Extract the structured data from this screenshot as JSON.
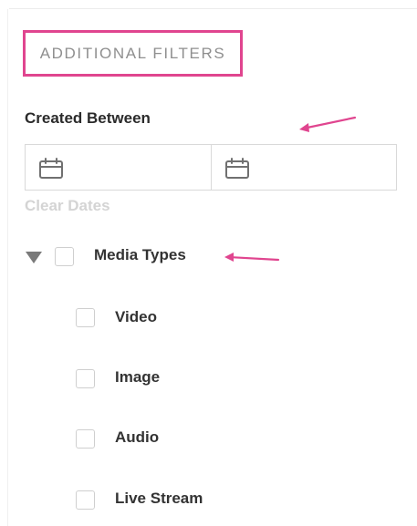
{
  "panel": {
    "header": "ADDITIONAL FILTERS",
    "created_between_label": "Created Between",
    "start_date": {
      "value": "",
      "icon": "calendar-icon"
    },
    "end_date": {
      "value": "",
      "icon": "calendar-icon"
    },
    "clear_dates_label": "Clear Dates"
  },
  "media_types": {
    "label": "Media Types",
    "expanded": true,
    "checked": false,
    "options": [
      {
        "label": "Video",
        "checked": false
      },
      {
        "label": "Image",
        "checked": false
      },
      {
        "label": "Audio",
        "checked": false
      },
      {
        "label": "Live Stream",
        "checked": false
      }
    ]
  },
  "colors": {
    "highlight": "#e0458f",
    "annotation_arrow": "#e0458f",
    "disabled_text": "#d4d4d4"
  }
}
